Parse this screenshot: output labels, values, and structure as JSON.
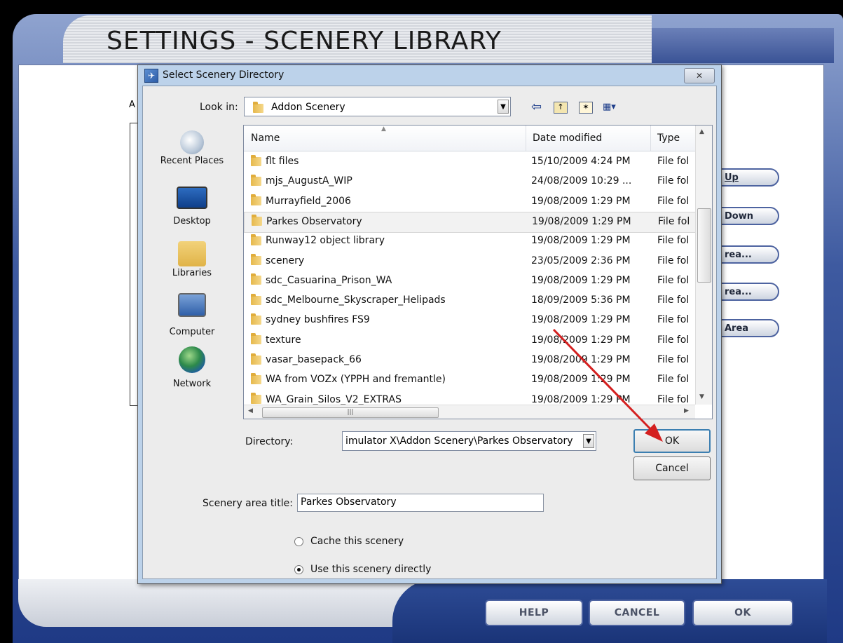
{
  "window": {
    "title": "SETTINGS - SCENERY LIBRARY",
    "side_label_a": "A",
    "side_buttons": [
      "Up",
      "Down",
      "rea...",
      "rea...",
      "Area"
    ],
    "bottom_buttons": {
      "help": "HELP",
      "cancel": "CANCEL",
      "ok": "OK"
    }
  },
  "dialog": {
    "title": "Select Scenery Directory",
    "close_glyph": "✕",
    "look_in_label": "Look in:",
    "look_in_value": "Addon Scenery",
    "toolbar_icons": [
      "back-arrow-icon",
      "up-folder-icon",
      "new-folder-icon",
      "view-menu-icon"
    ],
    "places": [
      {
        "label": "Recent Places",
        "icon": "recent-places-icon"
      },
      {
        "label": "Desktop",
        "icon": "desktop-icon"
      },
      {
        "label": "Libraries",
        "icon": "libraries-icon"
      },
      {
        "label": "Computer",
        "icon": "computer-icon"
      },
      {
        "label": "Network",
        "icon": "network-icon"
      }
    ],
    "columns": {
      "name": "Name",
      "date": "Date modified",
      "type": "Type"
    },
    "files": [
      {
        "name": "flt files",
        "date": "15/10/2009 4:24 PM",
        "type": "File fol"
      },
      {
        "name": "mjs_AugustA_WIP",
        "date": "24/08/2009 10:29 ...",
        "type": "File fol"
      },
      {
        "name": "Murrayfield_2006",
        "date": "19/08/2009 1:29 PM",
        "type": "File fol"
      },
      {
        "name": "Parkes Observatory",
        "date": "19/08/2009 1:29 PM",
        "type": "File fol",
        "selected": true
      },
      {
        "name": "Runway12 object library",
        "date": "19/08/2009 1:29 PM",
        "type": "File fol"
      },
      {
        "name": "scenery",
        "date": "23/05/2009 2:36 PM",
        "type": "File fol"
      },
      {
        "name": "sdc_Casuarina_Prison_WA",
        "date": "19/08/2009 1:29 PM",
        "type": "File fol"
      },
      {
        "name": "sdc_Melbourne_Skyscraper_Helipads",
        "date": "18/09/2009 5:36 PM",
        "type": "File fol"
      },
      {
        "name": "sydney bushfires FS9",
        "date": "19/08/2009 1:29 PM",
        "type": "File fol"
      },
      {
        "name": "texture",
        "date": "19/08/2009 1:29 PM",
        "type": "File fol"
      },
      {
        "name": "vasar_basepack_66",
        "date": "19/08/2009 1:29 PM",
        "type": "File fol"
      },
      {
        "name": "WA from VOZx (YPPH and fremantle)",
        "date": "19/08/2009 1:29 PM",
        "type": "File fol"
      },
      {
        "name": "WA_Grain_Silos_V2_EXTRAS",
        "date": "19/08/2009 1:29 PM",
        "type": "File fol"
      }
    ],
    "directory_label": "Directory:",
    "directory_value": "imulator X\\Addon Scenery\\Parkes Observatory",
    "ok_label": "OK",
    "cancel_label": "Cancel",
    "scenery_title_label": "Scenery area title:",
    "scenery_title_value": "Parkes Observatory",
    "radio_cache": "Cache this scenery",
    "radio_direct": "Use this scenery directly",
    "selected_radio": "direct"
  },
  "colors": {
    "annotation_arrow": "#d42020",
    "fsx_blue": "#2e4c96"
  }
}
